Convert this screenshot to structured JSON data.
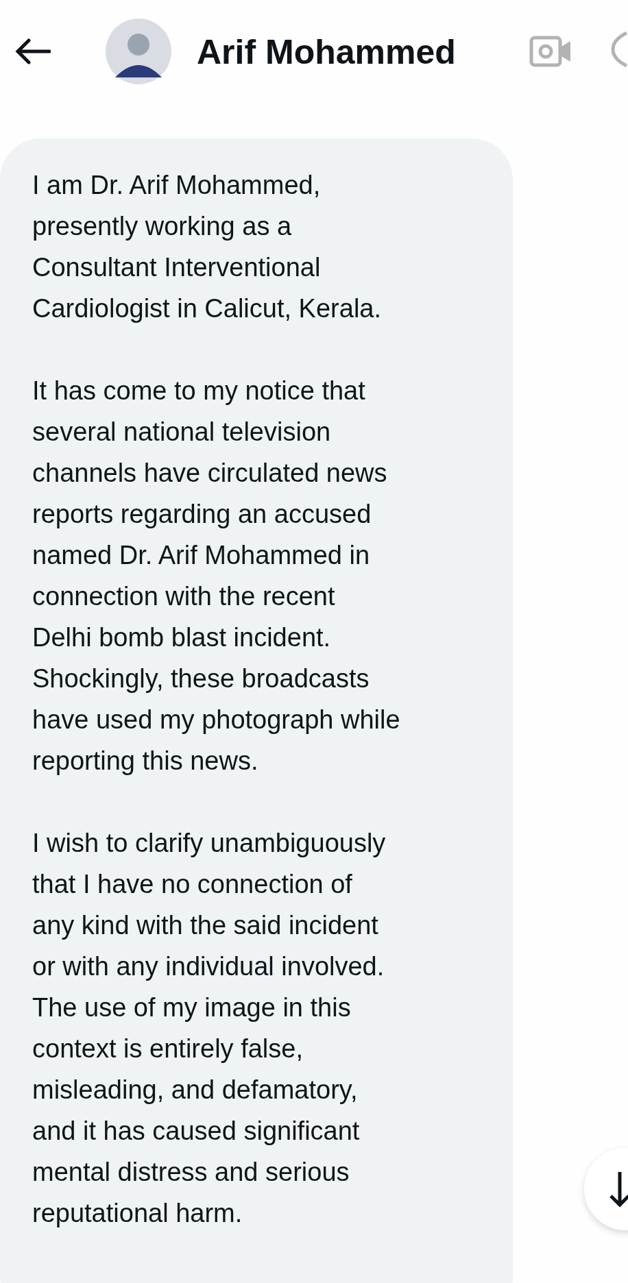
{
  "header": {
    "title": "Arif Mohammed"
  },
  "message": {
    "paragraphs": [
      [
        "I am Dr. Arif Mohammed,",
        "presently working as a",
        "Consultant Interventional",
        "Cardiologist in Calicut, Kerala."
      ],
      [
        "It has come to my notice that",
        "several national television",
        "channels have circulated news",
        "reports regarding an accused",
        "named Dr. Arif Mohammed in",
        "connection with the recent",
        "Delhi bomb blast incident.",
        "Shockingly, these broadcasts",
        "have used my photograph while",
        "reporting this news."
      ],
      [
        "I wish to clarify unambiguously",
        "that I have no connection of",
        "any kind with the said incident",
        "or with any individual involved.",
        "The use of my image in this",
        "context is entirely false,",
        "misleading, and defamatory,",
        "and it has caused significant",
        "mental distress and serious",
        "reputational harm."
      ]
    ]
  }
}
